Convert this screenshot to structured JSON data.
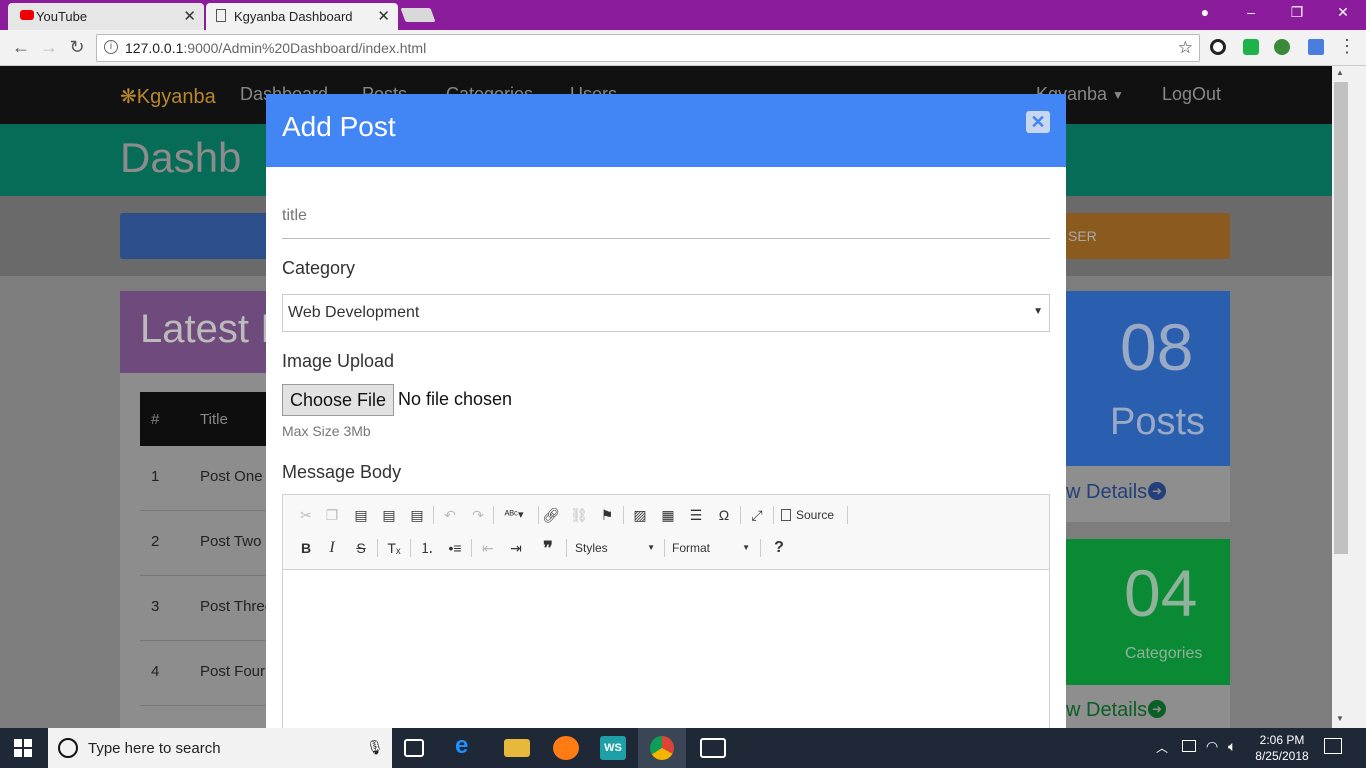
{
  "browser": {
    "tabs": [
      {
        "title": "YouTube",
        "active": false
      },
      {
        "title": "Kgyanba Dashboard",
        "active": true
      }
    ],
    "url_host": "127.0.0.1",
    "url_rest": ":9000/Admin%20Dashboard/index.html"
  },
  "nav": {
    "brand": "❋Kgyanba",
    "items": [
      "Dashboard",
      "Posts",
      "Categories",
      "Users"
    ],
    "user": "Kgyanba",
    "logout": "LogOut"
  },
  "hero": {
    "title": "Dashb"
  },
  "action_button_fragment": "SER",
  "latest": {
    "title": "Latest I",
    "columns": [
      "#",
      "Title"
    ],
    "rows": [
      {
        "num": "1",
        "title": "Post One"
      },
      {
        "num": "2",
        "title": "Post Two"
      },
      {
        "num": "3",
        "title": "Post Three"
      },
      {
        "num": "4",
        "title": "Post Four"
      }
    ]
  },
  "stats": [
    {
      "count": "08",
      "label": "Posts",
      "link": "w Details",
      "color": "#2a5fb0"
    },
    {
      "count": "04",
      "label": "Categories",
      "link": "w Details",
      "color": "#0b8a35"
    }
  ],
  "modal": {
    "title": "Add Post",
    "title_placeholder": "title",
    "category_label": "Category",
    "category_value": "Web Development",
    "image_label": "Image Upload",
    "choose_file": "Choose File",
    "no_file": "No file chosen",
    "max_size": "Max Size 3Mb",
    "message_label": "Message Body",
    "editor": {
      "source_label": "Source",
      "styles_label": "Styles",
      "format_label": "Format"
    },
    "header_color": "#4285f4"
  },
  "taskbar": {
    "search_placeholder": "Type here to search",
    "time": "2:06 PM",
    "date": "8/25/2018"
  }
}
